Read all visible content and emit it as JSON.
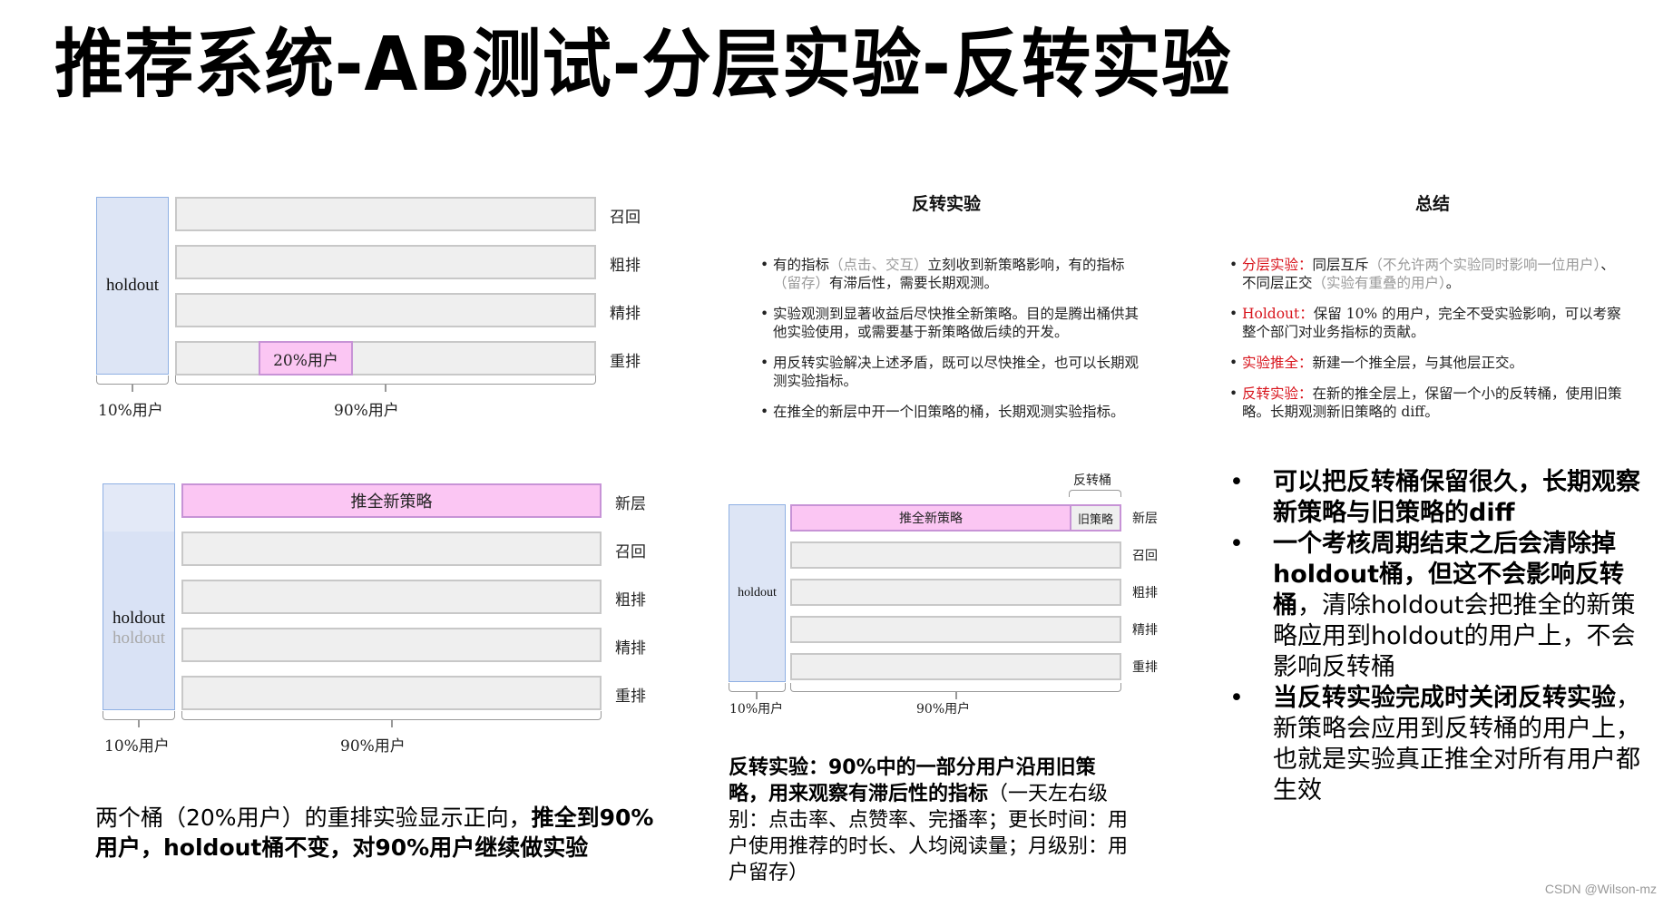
{
  "title": "推荐系统-AB测试-分层实验-反转实验",
  "diagram1": {
    "holdout_label": "holdout",
    "layers": [
      "召回",
      "粗排",
      "精排",
      "重排"
    ],
    "experiment_bucket": "20%用户",
    "holdout_share": "10%用户",
    "experiment_share": "90%用户"
  },
  "diagram2": {
    "holdout_label": "holdout",
    "holdout_label_faded": "holdout",
    "new_layer_bar": "推全新策略",
    "layers": [
      "新层",
      "召回",
      "粗排",
      "精排",
      "重排"
    ],
    "holdout_share": "10%用户",
    "experiment_share": "90%用户"
  },
  "diagram3": {
    "holdout_label": "holdout",
    "new_layer_bar": "推全新策略",
    "reverse_bucket_title": "反转桶",
    "reverse_bucket_label": "旧策略",
    "layers": [
      "新层",
      "召回",
      "粗排",
      "精排",
      "重排"
    ],
    "holdout_share": "10%用户",
    "experiment_share": "90%用户"
  },
  "reverse_panel": {
    "title": "反转实验",
    "items": [
      {
        "pre": "有的指标",
        "grey1": "（点击、交互）",
        "mid": "立刻收到新策略影响，有的指标",
        "grey2": "（留存）",
        "post": "有滞后性，需要长期观测。"
      },
      {
        "text": "实验观测到显著收益后尽快推全新策略。目的是腾出桶供其他实验使用，或需要基于新策略做后续的开发。"
      },
      {
        "text": "用反转实验解决上述矛盾，既可以尽快推全，也可以长期观测实验指标。"
      },
      {
        "text": "在推全的新层中开一个旧策略的桶，长期观测实验指标。"
      }
    ]
  },
  "summary_panel": {
    "title": "总结",
    "items": [
      {
        "key": "分层实验：",
        "text": "同层互斥",
        "grey1": "（不允许两个实验同时影响一位用户）",
        "text2": "、不同层正交",
        "grey2": "（实验有重叠的用户）",
        "text3": "。"
      },
      {
        "key": "Holdout：",
        "text": "保留 10% 的用户，完全不受实验影响，可以考察整个部门对业务指标的贡献。"
      },
      {
        "key": "实验推全：",
        "text": "新建一个推全层，与其他层正交。"
      },
      {
        "key": "反转实验：",
        "text": "在新的推全层上，保留一个小的反转桶，使用旧策略。长期观测新旧策略的 diff。"
      }
    ],
    "accent_color": "#d8141c"
  },
  "notes": {
    "bullets": [
      {
        "bold": "可以把反转桶保留很久，长期观察新策略与旧策略的diff",
        "normal": ""
      },
      {
        "bold": "一个考核周期结束之后会清除掉holdout桶，但这不会影响反转桶",
        "normal": "，清除holdout会把推全的新策略应用到holdout的用户上，不会影响反转桶"
      },
      {
        "bold": "当反转实验完成时关闭反转实验",
        "normal": "，新策略会应用到反转桶的用户上，也就是实验真正推全对所有用户都生效"
      }
    ],
    "bullet_glyph": "•"
  },
  "caption_left": {
    "normal": "两个桶（20%用户）的重排实验显示正向，",
    "bold": "推全到90%用户，holdout桶不变，对90%用户继续做实验"
  },
  "caption_middle": {
    "bold": "反转实验：90%中的一部分用户沿用旧策略，用来观察有滞后性的指标",
    "normal": "（一天左右级别：点击率、点赞率、完播率；更长时间：用户使用推荐的时长、人均阅读量；月级别：用户留存）"
  },
  "watermark": "CSDN @Wilson-mz"
}
